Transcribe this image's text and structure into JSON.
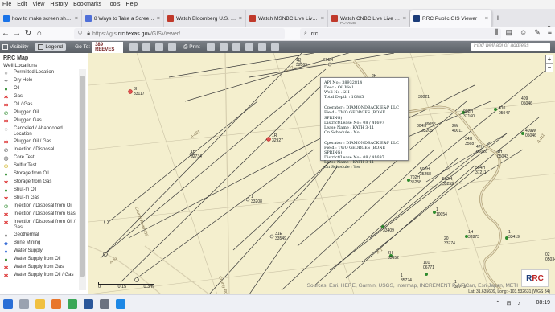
{
  "menu": [
    "File",
    "Edit",
    "View",
    "History",
    "Bookmarks",
    "Tools",
    "Help"
  ],
  "tabs": [
    {
      "title": "how to make screen shot windo",
      "color": "#1a73e8",
      "sub": ""
    },
    {
      "title": "8 Ways to Take a Screenshot on",
      "color": "#4f6fd8",
      "sub": ""
    },
    {
      "title": "Watch Bloomberg U.S. Live TV F",
      "color": "#c0392b",
      "sub": ""
    },
    {
      "title": "Watch MSNBC Live Live TV fro",
      "color": "#c0392b",
      "sub": ""
    },
    {
      "title": "Watch CNBC Live Live TV from",
      "color": "#c0392b",
      "sub": "PLAYING"
    },
    {
      "title": "RRC Public GIS Viewer",
      "color": "#1c3d7a",
      "sub": "",
      "active": true
    }
  ],
  "url": {
    "prefix": "https://gis.",
    "domain": "rrc.texas.gov",
    "path": "/GISViewer/"
  },
  "search": {
    "value": "rrc"
  },
  "toolbar": {
    "visibility": "Visibility",
    "legend": "Legend",
    "goto_label": "Go To:",
    "goto_value": "389 REEVES",
    "print": "Print",
    "find_placeholder": "Find well api or address"
  },
  "sidebar": {
    "title": "RRC Map",
    "subtitle": "Well Locations",
    "items": [
      {
        "label": "Permitted Location",
        "sym": "○",
        "color": "#333"
      },
      {
        "label": "Dry Hole",
        "sym": "✧",
        "color": "#333"
      },
      {
        "label": "Oil",
        "sym": "●",
        "color": "#2e8b2e"
      },
      {
        "label": "Gas",
        "sym": "✱",
        "color": "#d33"
      },
      {
        "label": "Oil / Gas",
        "sym": "✱",
        "color": "#d33"
      },
      {
        "label": "Plugged Oil",
        "sym": "⊘",
        "color": "#2e8b2e"
      },
      {
        "label": "Plugged Gas",
        "sym": "✱",
        "color": "#d33"
      },
      {
        "label": "Canceled / Abandoned Location",
        "sym": "◌",
        "color": "#555"
      },
      {
        "label": "Plugged Oil / Gas",
        "sym": "✱",
        "color": "#d33"
      },
      {
        "label": "Injection / Disposal",
        "sym": "⊘",
        "color": "#555"
      },
      {
        "label": "Core Test",
        "sym": "◍",
        "color": "#555"
      },
      {
        "label": "Sulfur Test",
        "sym": "⊕",
        "color": "#c8a800"
      },
      {
        "label": "Storage from Oil",
        "sym": "●",
        "color": "#2e8b2e"
      },
      {
        "label": "Storage from Gas",
        "sym": "✱",
        "color": "#d33"
      },
      {
        "label": "Shut-In Oil",
        "sym": "●",
        "color": "#2e8b2e"
      },
      {
        "label": "Shut-In Gas",
        "sym": "✱",
        "color": "#d33"
      },
      {
        "label": "Injection / Disposal from Oil",
        "sym": "⊘",
        "color": "#2e8b2e"
      },
      {
        "label": "Injection / Disposal from Gas",
        "sym": "✱",
        "color": "#d33"
      },
      {
        "label": "Injection / Disposal from Oil / Gas",
        "sym": "✱",
        "color": "#d33"
      },
      {
        "label": "Geothermal",
        "sym": "●",
        "color": "#888"
      },
      {
        "label": "Brine Mining",
        "sym": "◆",
        "color": "#3a6fd8"
      },
      {
        "label": "Water Supply",
        "sym": "●",
        "color": "#3a6fd8"
      },
      {
        "label": "Water Supply from Oil",
        "sym": "●",
        "color": "#2e8b2e"
      },
      {
        "label": "Water Supply from Gas",
        "sym": "✱",
        "color": "#d33"
      },
      {
        "label": "Water Supply from Oil / Gas",
        "sym": "✱",
        "color": "#d33"
      }
    ]
  },
  "popup": {
    "records": [
      {
        "api": "API No : 38932814",
        "desc": "Desc : Oil Well",
        "well": "Well No : 2H",
        "depth": "Total Depth : 10885",
        "operator": "Operator : DIAMONDBACK E&P LLC",
        "field": "Field : TWO GEORGES (BONE SPRING)",
        "district": "District/Lease No : 08 / 41697",
        "lease": "Lease Name : KATH 3-11",
        "schedule": "On Schedule : No"
      },
      {
        "operator": "Operator : DIAMONDBACK E&P LLC",
        "field": "Field : TWO GEORGES (BONE SPRING)",
        "district": "District/Lease No : 08 / 41697",
        "lease": "Lease Name : KATH 3-11",
        "schedule": "On Schedule : Yes"
      }
    ]
  },
  "map_labels": [
    "1D",
    "33569",
    "601H",
    "2H",
    "32814",
    "3H",
    "33117",
    "1R",
    "32927",
    "1H",
    "32734",
    "1",
    "33208",
    "31E",
    "33549",
    "4H",
    "35027",
    "33021",
    "804H",
    "33205",
    "2H",
    "410",
    "05047",
    "409",
    "05046",
    "409W",
    "05046",
    "1H",
    "05043",
    "3114",
    "902H",
    "37160",
    "39055",
    "2W",
    "40011",
    "47H",
    "05026",
    "34H",
    "35687",
    "702H",
    "35258",
    "502H",
    "35258",
    "502H",
    "35259",
    "504H",
    "37211",
    "1",
    "10054",
    "1H",
    "32873",
    "1",
    "33419",
    "1",
    "33409",
    "02",
    "05034",
    "2H",
    "33652",
    "101",
    "06771",
    "20",
    "33774",
    "1",
    "35774",
    "1",
    "30773"
  ],
  "road_labels": [
    "A-421",
    "A-19",
    "County Road 419",
    "A-51",
    "A-111",
    "County Road 419",
    "A-77",
    "A-1"
  ],
  "scale": {
    "n0": "0",
    "n1": "0.15",
    "n2": "0.3mi"
  },
  "attribution": "Sources: Esri, HERE, Garmin, USGS, Intermap, INCREMENT P, NRCan, Esri Japan, METI",
  "coords": "Lat: 31.635609, Long: -103.532631 (WGS 84)",
  "logo": {
    "a": "R",
    "b": "RC"
  },
  "clock": "08:19"
}
